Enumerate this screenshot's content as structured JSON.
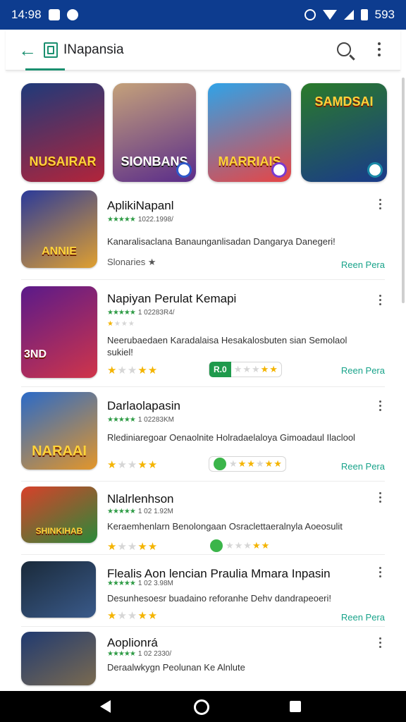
{
  "status_bar": {
    "time": "14:98",
    "battery": "593"
  },
  "app_bar": {
    "title": "INapansia"
  },
  "featured": [
    {
      "caption": "NUSAIRAR",
      "colors": [
        "#1e3a7a",
        "#b3243a"
      ]
    },
    {
      "caption": "SIONBANS",
      "colors": [
        "#c4a17a",
        "#5a2c8a"
      ]
    },
    {
      "caption": "MARRIAIS",
      "colors": [
        "#2fa3e8",
        "#e84545"
      ]
    },
    {
      "caption": "SAMDSAI",
      "colors": [
        "#2a7a2a",
        "#1a3a8a"
      ]
    }
  ],
  "rows": [
    {
      "name": "AplikiNapanl",
      "meta": "1022.1998/",
      "desc": "Kanaralisaclana Banaunganlisadan Dangarya Danegeri!",
      "sub": "Slonaries ★",
      "action": "Reen Pera",
      "thumb_caption": "ANNIE",
      "thumb_colors": [
        "#2a3a9a",
        "#e0a030"
      ]
    },
    {
      "name": "Napiyan Perulat Kemapi",
      "meta": "1 02283R4/",
      "desc": "Neerubaedaen Karadalaisa Hesakalosbuten sian Semolaol sukiel!",
      "action": "Reen Pera",
      "pill_label": "R.0",
      "thumb_caption": "3ND",
      "thumb_colors": [
        "#5a1a8a",
        "#d0354a"
      ]
    },
    {
      "name": "Darlaolapasin",
      "meta": "1 02283KM",
      "desc": "Rlediniaregoar Oenaolnite Holradaelaloya Gimoadaul Ilaclool",
      "action": "Reen Pera",
      "thumb_caption": "NARAAI",
      "thumb_colors": [
        "#2a6ac8",
        "#e3962a"
      ]
    },
    {
      "name": "Nlalrlenhson",
      "meta": "1 02 1.92M",
      "desc": "Keraemhenlarn Benolongaan Osraclettaeralnyla Aoeosulit",
      "thumb_caption": "SHINKIHAB",
      "thumb_colors": [
        "#d8402a",
        "#2a8a3a"
      ]
    },
    {
      "name": "Flealis Aon lencian Praulia Mmara Inpasin",
      "meta": "1 02 3.98M",
      "desc": "Desunhesoesr buadaino reforanhe Dehv dandrapeoeri!",
      "action": "Reen Pera",
      "thumb_colors": [
        "#1a2a3a",
        "#3a5a8a"
      ]
    },
    {
      "name": "Aoplionrá",
      "meta": "1 02 2330/",
      "desc": "Deraalwkygn Peolunan Ke Alnlute",
      "thumb_colors": [
        "#203a70",
        "#7a6a50"
      ]
    }
  ]
}
